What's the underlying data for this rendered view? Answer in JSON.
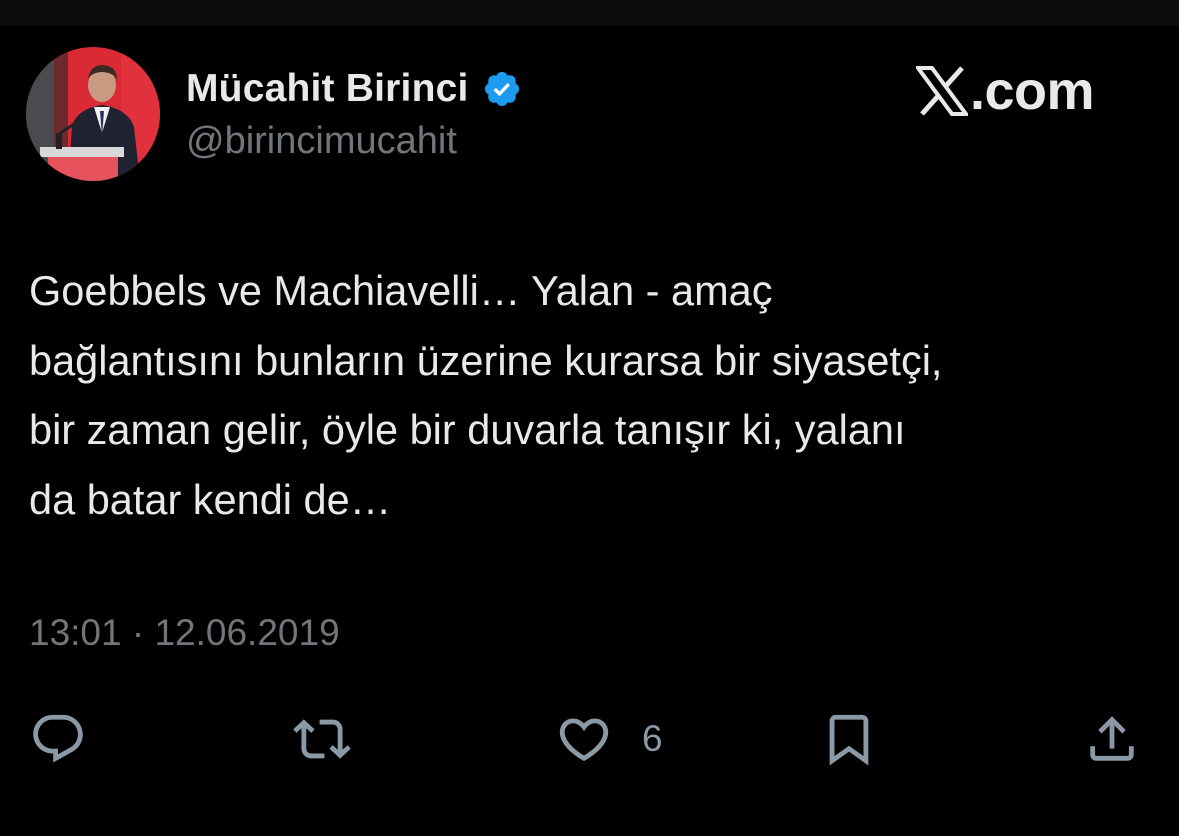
{
  "tweet": {
    "author": {
      "display_name": "Mücahit Birinci",
      "handle": "@birincimucahit",
      "verified": true,
      "avatar_icon": "profile-photo"
    },
    "brand": {
      "text": ".com",
      "icon": "x-logo-icon"
    },
    "text_lines": [
      "Goebbels ve Machiavelli… Yalan - amaç",
      "bağlantısını bunların üzerine kurarsa bir siyasetçi,",
      "bir zaman gelir, öyle bir duvarla tanışır ki, yalanı",
      "da batar kendi de…"
    ],
    "timestamp": "13:01 · 12.06.2019",
    "actions": {
      "reply_icon": "reply-icon",
      "retweet_icon": "retweet-icon",
      "like_icon": "heart-icon",
      "like_count": "6",
      "bookmark_icon": "bookmark-icon",
      "share_icon": "share-icon"
    }
  },
  "colors": {
    "background": "#000000",
    "primary_text": "#e7e9ea",
    "secondary_text": "#71767b",
    "verified_blue": "#1d9bf0"
  }
}
